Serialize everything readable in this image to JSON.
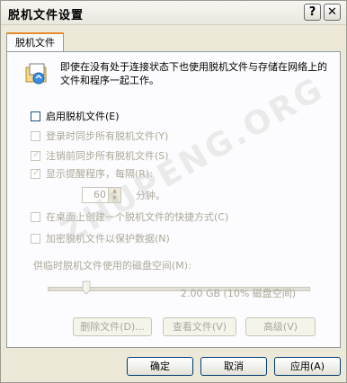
{
  "window": {
    "title": "脱机文件设置"
  },
  "titlebar_buttons": {
    "help": "?",
    "close": "✕"
  },
  "tab": {
    "label": "脱机文件"
  },
  "description": "即使在没有处于连接状态下也使用脱机文件与存储在网络上的文件和程序一起工作。",
  "options": {
    "enable": "启用脱机文件(E)",
    "sync_logon": "登录时同步所有脱机文件(Y)",
    "sync_logoff": "注销前同步所有脱机文件(S)",
    "reminder": "显示提醒程序，每隔(R):",
    "shortcut": "在桌面上创建一个脱机文件的快捷方式(C)",
    "encrypt": "加密脱机文件以保护数据(N)"
  },
  "reminder_interval": {
    "value": "60",
    "suffix": "分钟。"
  },
  "space": {
    "label": "供临时脱机文件使用的磁盘空间(M):",
    "value": "2.00 GB (10% 磁盘空间)",
    "fraction": 0.1
  },
  "panel_buttons": {
    "delete": "删除文件(D)...",
    "view": "查看文件(V)",
    "advanced": "高级(V)"
  },
  "dialog_buttons": {
    "ok": "确定",
    "cancel": "取消",
    "apply": "应用(A)"
  },
  "watermark": "ZHUPENG.ORG"
}
